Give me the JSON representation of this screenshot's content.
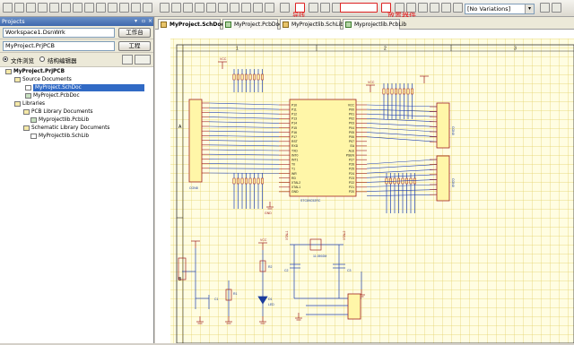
{
  "panel": {
    "title": "Projects",
    "workspace_value": "Workspace1.DsnWrk",
    "workspace_button": "工作台",
    "project_value": "MyProject.PrjPCB",
    "project_button": "工程",
    "view_file": "文件浏览",
    "view_structure": "结构编辑器",
    "tree": [
      {
        "label": "MyProject.PrjPCB",
        "level": 0,
        "bold": true,
        "selected": false
      },
      {
        "label": "Source Documents",
        "level": 1,
        "bold": false,
        "selected": false
      },
      {
        "label": "MyProject.SchDoc",
        "level": 2,
        "bold": false,
        "selected": true
      },
      {
        "label": "MyProject.PcbDoc",
        "level": 2,
        "bold": false,
        "selected": false
      },
      {
        "label": "Libraries",
        "level": 1,
        "bold": false,
        "selected": false
      },
      {
        "label": "PCB Library Documents",
        "level": 2,
        "bold": false,
        "selected": false
      },
      {
        "label": "Myprojectlib.PcbLib",
        "level": 3,
        "bold": false,
        "selected": false
      },
      {
        "label": "Schematic Library Documents",
        "level": 2,
        "bold": false,
        "selected": false
      },
      {
        "label": "MyProjectlib.SchLib",
        "level": 3,
        "bold": false,
        "selected": false
      }
    ]
  },
  "toolbar": {
    "variations": "[No Variations]",
    "annotation_wire": "导线",
    "annotation_place": "放置器件"
  },
  "tabs": [
    {
      "label": "MyProject.SchDoc",
      "active": true
    },
    {
      "label": "MyProject.PcbDoc",
      "active": false
    },
    {
      "label": "MyProjectlib.SchLib",
      "active": false
    },
    {
      "label": "Myprojectlib.PcbLib",
      "active": false
    }
  ],
  "schematic": {
    "zone_top_1": "1",
    "zone_top_2": "2",
    "zone_top_3": "3",
    "zone_left_a": "A",
    "zone_left_b": "B",
    "mcu_designator": "STC89C52RC",
    "mcu_pins_left": [
      "P10",
      "P11",
      "P12",
      "P13",
      "P14",
      "P15",
      "P16",
      "P17",
      "RST",
      "RXD",
      "TXD",
      "INT0",
      "INT1",
      "T0",
      "T1",
      "WR",
      "RD",
      "XTAL2",
      "XTAL1",
      "GND"
    ],
    "mcu_pins_right": [
      "VCC",
      "P00",
      "P01",
      "P02",
      "P03",
      "P04",
      "P05",
      "P06",
      "P07",
      "EA",
      "ALE",
      "PSEN",
      "P27",
      "P26",
      "P25",
      "P24",
      "P23",
      "P22",
      "P21",
      "P20"
    ],
    "vcc": "VCC",
    "gnd": "GND",
    "crystal": "11.0592M",
    "xtal1_label": "XTAL1",
    "xtal2_label": "XTAL2",
    "led_label": "LED",
    "conn_left": "CON8",
    "conn_right_top": "CON8",
    "conn_right_bottom": "CON8",
    "cap_c1": "C1",
    "cap_c2": "C2",
    "cap_c3": "C3",
    "res_r1": "R1",
    "res_r2": "R2",
    "diode_d1": "D1"
  }
}
